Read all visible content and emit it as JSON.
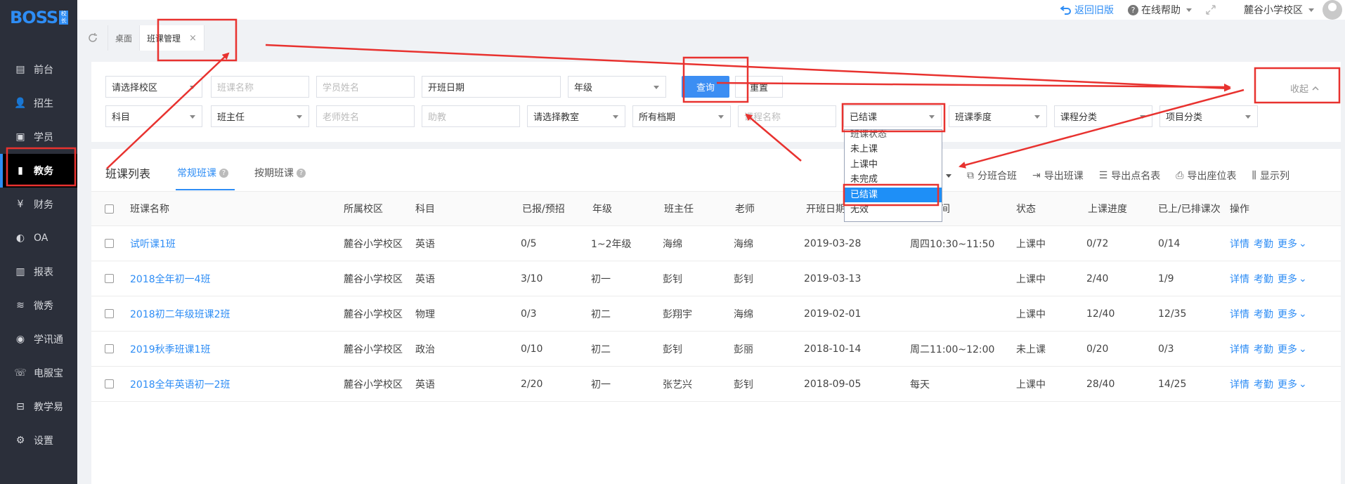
{
  "app": {
    "logo": "BOSS",
    "logo_badge": "校长"
  },
  "colors": {
    "accent": "#2e8df5",
    "sidebar_bg": "#2b2f3a",
    "annotation": "#e8322f",
    "selected": "#1e8ff7"
  },
  "sidebar": {
    "items": [
      {
        "label": "前台",
        "icon": "calendar-icon"
      },
      {
        "label": "招生",
        "icon": "user-add-icon"
      },
      {
        "label": "学员",
        "icon": "student-card-icon"
      },
      {
        "label": "教务",
        "icon": "book-icon",
        "active": true
      },
      {
        "label": "财务",
        "icon": "yen-coin-icon"
      },
      {
        "label": "OA",
        "icon": "oa-toggle-icon"
      },
      {
        "label": "报表",
        "icon": "bar-chart-icon"
      },
      {
        "label": "微秀",
        "icon": "wave-icon"
      },
      {
        "label": "学讯通",
        "icon": "location-pin-icon"
      },
      {
        "label": "电服宝",
        "icon": "phone-icon"
      },
      {
        "label": "教学易",
        "icon": "teach-icon"
      },
      {
        "label": "设置",
        "icon": "gear-icon"
      }
    ]
  },
  "topbar": {
    "back_old": "返回旧版",
    "online_help": "在线帮助",
    "campus": "麓谷小学校区"
  },
  "tabs": [
    {
      "label": "桌面"
    },
    {
      "label": "班课管理",
      "active": true
    }
  ],
  "filters": {
    "campus": "请选择校区",
    "class_name": "班课名称",
    "student_name": "学员姓名",
    "start_date": "开班日期",
    "grade": "年级",
    "query": "查询",
    "reset": "重置",
    "collapse": "收起",
    "subject": "科目",
    "head_teacher": "班主任",
    "teacher_name": "老师姓名",
    "assistant": "助教",
    "classroom": "请选择教室",
    "schedule": "所有档期",
    "course_name": "课程名称",
    "status": "已结课",
    "season": "班课季度",
    "course_category": "课程分类",
    "project_category": "项目分类"
  },
  "status_dropdown": {
    "options": [
      "班课状态",
      "未上课",
      "上课中",
      "未完成",
      "已结课",
      "无效"
    ],
    "selected": "已结课"
  },
  "panel": {
    "title": "班课列表",
    "tab_regular": "常规班课",
    "tab_period": "按期班课",
    "toolbar": [
      "分班合班",
      "导出班课",
      "导出点名表",
      "导出座位表",
      "显示列"
    ]
  },
  "table": {
    "headers": [
      "班课名称",
      "所属校区",
      "科目",
      "已报/预招",
      "年级",
      "班主任",
      "老师",
      "开班日期",
      "上课时间",
      "状态",
      "上课进度",
      "已上/已排课次",
      "操作"
    ],
    "header_time_visible": "间",
    "rows": [
      {
        "name": "试听课1班",
        "campus": "麓谷小学校区",
        "subject": "英语",
        "enrolled": "0/5",
        "grade": "1~2年级",
        "head": "海绵",
        "teacher": "海绵",
        "date": "2019-03-28",
        "time": "周四10:30~11:50",
        "status": "上课中",
        "progress": "0/72",
        "lessons": "0/14"
      },
      {
        "name": "2018全年初一4班",
        "campus": "麓谷小学校区",
        "subject": "英语",
        "enrolled": "3/10",
        "grade": "初一",
        "head": "彭钊",
        "teacher": "彭钊",
        "date": "2019-03-13",
        "time": "",
        "status": "上课中",
        "progress": "2/40",
        "lessons": "1/9"
      },
      {
        "name": "2018初二年级班课2班",
        "campus": "麓谷小学校区",
        "subject": "物理",
        "enrolled": "0/3",
        "grade": "初二",
        "head": "彭翔宇",
        "teacher": "海绵",
        "date": "2019-02-01",
        "time": "",
        "status": "上课中",
        "progress": "12/40",
        "lessons": "12/35"
      },
      {
        "name": "2019秋季班课1班",
        "campus": "麓谷小学校区",
        "subject": "政治",
        "enrolled": "0/10",
        "grade": "初二",
        "head": "彭钊",
        "teacher": "彭丽",
        "date": "2018-10-14",
        "time": "周二11:00~12:00",
        "status": "未上课",
        "progress": "0/20",
        "lessons": "0/3"
      },
      {
        "name": "2018全年英语初一2班",
        "campus": "麓谷小学校区",
        "subject": "英语",
        "enrolled": "2/20",
        "grade": "初一",
        "head": "张艺兴",
        "teacher": "彭钊",
        "date": "2018-09-05",
        "time": "每天",
        "status": "上课中",
        "progress": "28/40",
        "lessons": "14/25"
      }
    ],
    "ops": {
      "detail": "详情",
      "attendance": "考勤",
      "more": "更多"
    }
  }
}
